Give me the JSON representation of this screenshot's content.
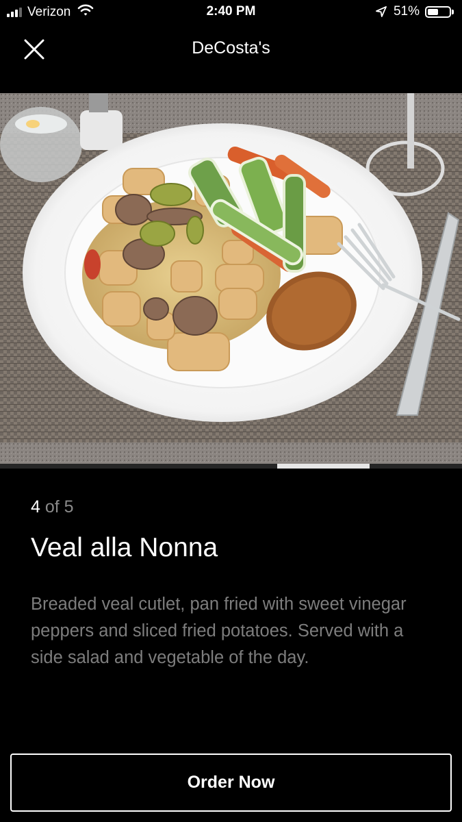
{
  "status_bar": {
    "carrier": "Verizon",
    "time": "2:40 PM",
    "battery_percent": "51%",
    "battery_level": 0.51,
    "signal_bars_active": 3,
    "signal_bars_total": 4
  },
  "header": {
    "title": "DeCosta's",
    "close_icon": "close-icon"
  },
  "gallery": {
    "current": "4",
    "separator": "of",
    "total": "5",
    "current_index": 4,
    "total_count": 5
  },
  "item": {
    "name": "Veal alla Nonna",
    "description": "Breaded veal cutlet, pan fried with sweet vinegar peppers and sliced fried potatoes. Served with a side salad and vegetable of the day."
  },
  "actions": {
    "order_label": "Order Now"
  },
  "colors": {
    "background": "#000000",
    "text_primary": "#ffffff",
    "text_secondary": "#7d7d7d"
  }
}
